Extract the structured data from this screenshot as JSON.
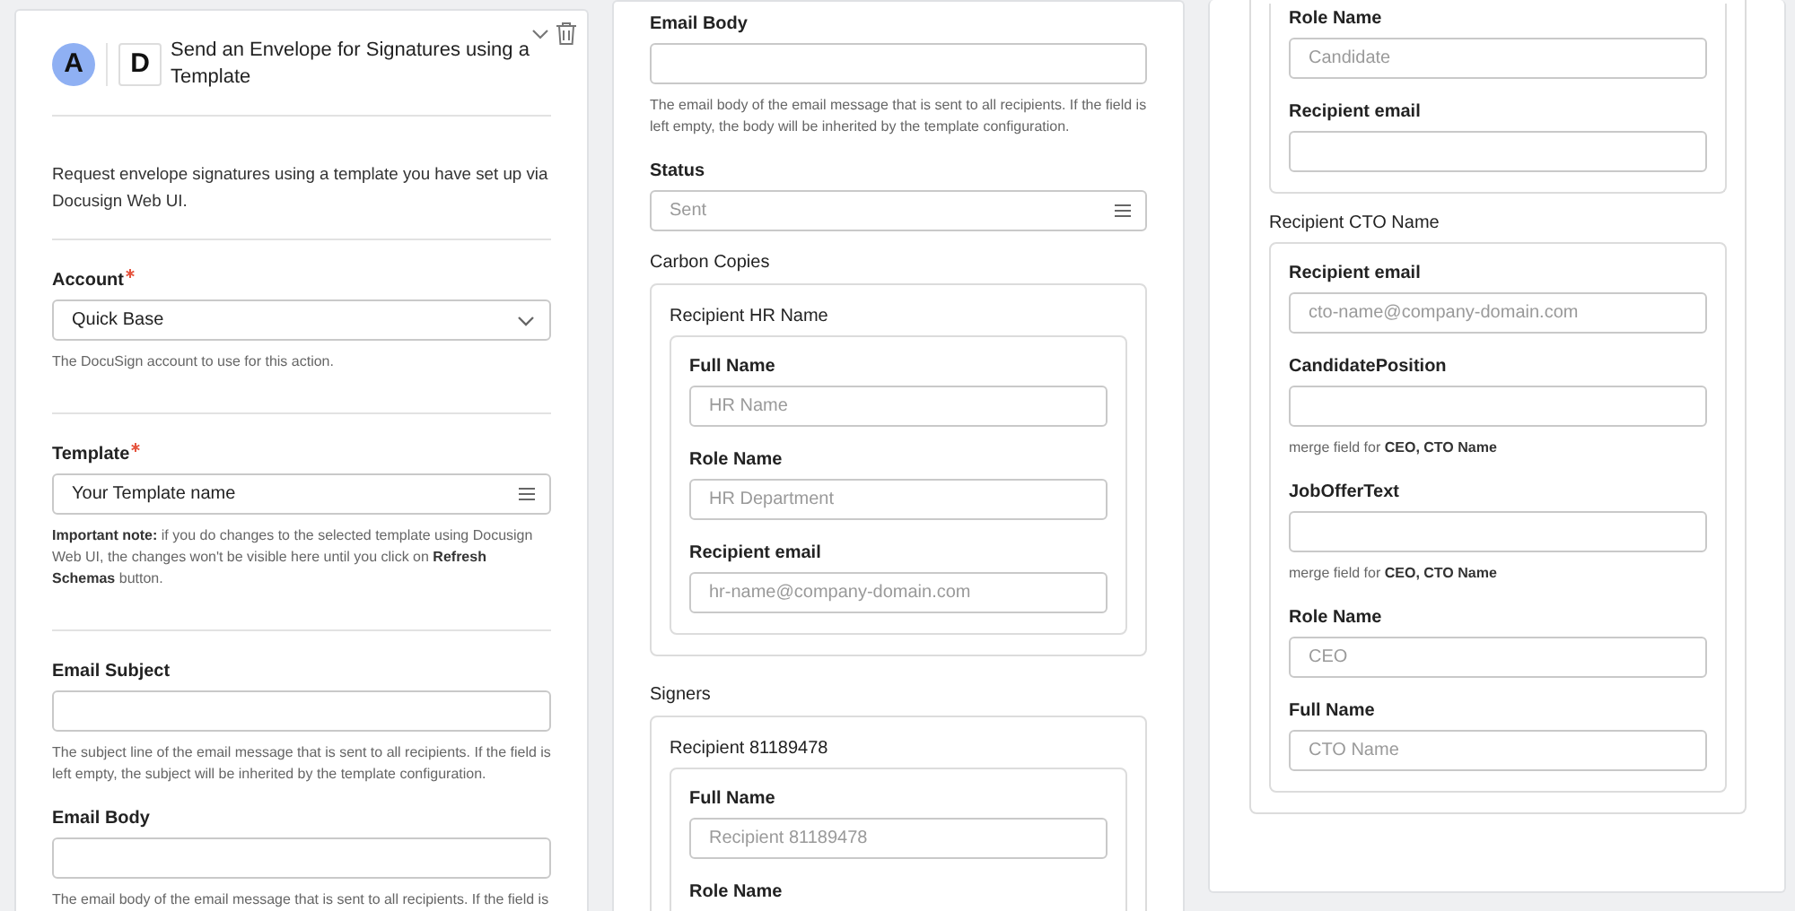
{
  "panels": [
    {
      "blocks": [
        {
          "kind": "header",
          "logo_letter": "A",
          "app_letter": "D",
          "title": "Send an Envelope for Signatures using a Template"
        },
        {
          "kind": "divider"
        },
        {
          "kind": "text",
          "text": "Request envelope signatures using a template you have set up via Docusign Web UI."
        },
        {
          "kind": "divider"
        },
        {
          "kind": "select_field",
          "label": "Account",
          "required": true,
          "value": "Quick Base",
          "help": "The DocuSign account to use for this action."
        },
        {
          "kind": "divider"
        },
        {
          "kind": "menu_field",
          "label": "Template",
          "required": true,
          "value": "Your Template name",
          "help": "**Important note:** if you do changes to the selected template using Docusign Web UI, the changes won't be visible here until you click on **Refresh Schemas** button."
        },
        {
          "kind": "divider"
        },
        {
          "kind": "text_field",
          "label": "Email Subject",
          "required": false,
          "help": "The subject line of the email message that is sent to all recipients. If the field is left empty, the subject will be inherited by the template configuration."
        },
        {
          "kind": "text_field",
          "label": "Email Body",
          "required": false,
          "help": "The email body of the email message that is sent to all recipients. If the field is"
        }
      ]
    },
    {
      "blocks": [
        {
          "kind": "text_field",
          "label": "Email Body",
          "required": false,
          "help": "The email body of the email message that is sent to all recipients. If the field is left empty, the body will be inherited by the template configuration."
        },
        {
          "kind": "menu_field",
          "label": "Status",
          "required": false,
          "placeholder": "Sent"
        },
        {
          "kind": "heading",
          "text": "Carbon Copies"
        },
        {
          "kind": "group",
          "blocks": [
            {
              "kind": "title",
              "text": "Recipient HR Name"
            },
            {
              "kind": "group",
              "blocks": [
                {
                  "kind": "text_field",
                  "label": "Full Name",
                  "required": false,
                  "placeholder": "HR Name"
                },
                {
                  "kind": "text_field",
                  "label": "Role Name",
                  "required": false,
                  "placeholder": "HR Department"
                },
                {
                  "kind": "text_field",
                  "label": "Recipient email",
                  "required": false,
                  "placeholder": "hr-name@company-domain.com"
                }
              ]
            }
          ]
        },
        {
          "kind": "heading",
          "text": "Signers"
        },
        {
          "kind": "group",
          "blocks": [
            {
              "kind": "title",
              "text": "Recipient 81189478"
            },
            {
              "kind": "group",
              "blocks": [
                {
                  "kind": "text_field",
                  "label": "Full Name",
                  "required": false,
                  "placeholder": "Recipient 81189478"
                },
                {
                  "kind": "text_field",
                  "label": "Role Name",
                  "required": false
                }
              ]
            }
          ]
        }
      ]
    },
    {
      "blocks": [
        {
          "kind": "group",
          "cut_top": true,
          "blocks": [
            {
              "kind": "group",
              "cut_top": true,
              "blocks": [
                {
                  "kind": "text_field",
                  "label": "Role Name",
                  "required": false,
                  "placeholder": "Candidate"
                },
                {
                  "kind": "text_field",
                  "label": "Recipient email",
                  "required": false
                }
              ]
            },
            {
              "kind": "title",
              "text": "Recipient CTO Name"
            },
            {
              "kind": "group",
              "blocks": [
                {
                  "kind": "text_field",
                  "label": "Recipient email",
                  "required": false,
                  "placeholder": "cto-name@company-domain.com"
                },
                {
                  "kind": "text_field",
                  "label": "CandidatePosition",
                  "required": false,
                  "help": "merge field for **CEO, CTO Name**"
                },
                {
                  "kind": "text_field",
                  "label": "JobOfferText",
                  "required": false,
                  "help": "merge field for **CEO, CTO Name**"
                },
                {
                  "kind": "text_field",
                  "label": "Role Name",
                  "required": false,
                  "placeholder": "CEO"
                },
                {
                  "kind": "text_field",
                  "label": "Full Name",
                  "required": false,
                  "placeholder": "CTO Name"
                }
              ]
            }
          ]
        }
      ]
    }
  ]
}
